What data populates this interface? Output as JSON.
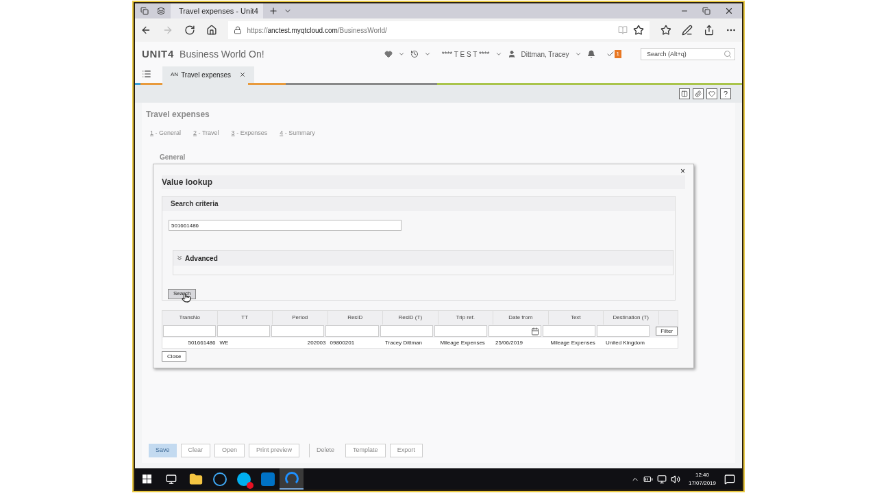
{
  "browser": {
    "tab_title": "Travel expenses - Unit4",
    "url": "https://**anctest.myqtcloud.com**/BusinessWorld/"
  },
  "app": {
    "logo": "UNIT4",
    "product": "Business World On!",
    "environment": "**** T E S T ****",
    "user": "Dittman, Tracey",
    "task_count": "1",
    "search": {
      "placeholder": "Search (Alt+q)"
    }
  },
  "tabs": [
    {
      "prefix": "AN",
      "label": "Travel expenses",
      "selected": true
    }
  ],
  "toolbar": {
    "help": "?"
  },
  "page": {
    "title": "Travel expenses",
    "steps": [
      {
        "number": "1",
        "label": "- General"
      },
      {
        "number": "2",
        "label": "- Travel"
      },
      {
        "number": "3",
        "label": "- Expenses"
      },
      {
        "number": "4",
        "label": "- Summary"
      }
    ],
    "section": "General"
  },
  "dialog": {
    "close": "×",
    "title": "Value lookup",
    "criteria_title": "Search criteria",
    "search_value": "501661486",
    "advanced": {
      "label": "Advanced",
      "expanded": false
    },
    "search_button": "Search",
    "columns": [
      {
        "label": "TransNo",
        "numeric": true
      },
      {
        "label": "TT",
        "numeric": false
      },
      {
        "label": "Period",
        "numeric": true
      },
      {
        "label": "ResID",
        "numeric": false
      },
      {
        "label": "ResID (T)",
        "numeric": false
      },
      {
        "label": "Trip ref.",
        "numeric": false
      },
      {
        "label": "Date from",
        "numeric": false,
        "date": true
      },
      {
        "label": "Text",
        "numeric": false
      },
      {
        "label": "Destination (T)",
        "numeric": false
      }
    ],
    "filter_button": "Filter",
    "rows": [
      [
        "501661486",
        "WE",
        "202003",
        "09800201",
        "Tracey Dittman",
        "Mileage Expenses",
        "25/06/2019",
        "Mileage Expenses",
        "United Kingdom"
      ]
    ],
    "close_button": "Close"
  },
  "footer": [
    {
      "label": "Save",
      "kind": "primary",
      "disabled": true
    },
    {
      "label": "Clear",
      "kind": "normal",
      "disabled": true
    },
    {
      "label": "Open",
      "kind": "normal",
      "disabled": true
    },
    {
      "label": "Print preview",
      "kind": "normal",
      "disabled": true
    },
    {
      "label": "Delete",
      "kind": "plain",
      "disabled": true
    },
    {
      "label": "Template",
      "kind": "normal",
      "disabled": true
    },
    {
      "label": "Export",
      "kind": "normal",
      "disabled": true
    }
  ],
  "taskbar": {
    "apps": [
      {
        "kind": "explorer",
        "selected": false
      },
      {
        "kind": "ie",
        "selected": false
      },
      {
        "kind": "skype",
        "selected": false
      },
      {
        "kind": "outlook",
        "selected": false
      },
      {
        "kind": "edge",
        "selected": true
      }
    ],
    "time": "12:40",
    "date": "17/07/2019"
  }
}
